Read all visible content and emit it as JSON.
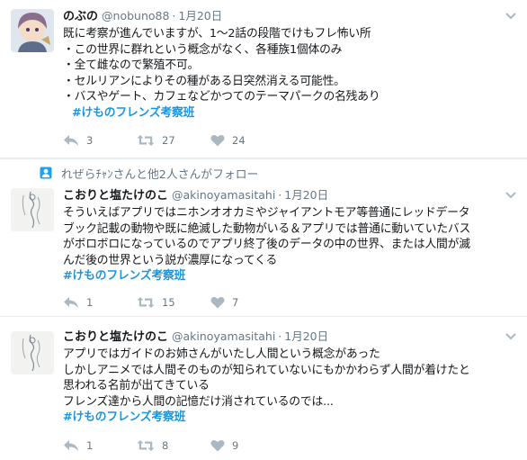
{
  "tweets": [
    {
      "name": "のぶの",
      "handle": "@nobuno88",
      "separator": "·",
      "time": "1月20日",
      "lines": [
        "既に考察が進んでいますが、1〜2話の段階でけもフレ怖い所",
        "・この世界に群れという概念がなく、各種族1個体のみ",
        "・全て雌なので繁殖不可。",
        "・セルリアンによりその種がある日突然消える可能性。",
        "・バスやゲート、カフェなどかつてのテーマパークの名残あり"
      ],
      "hashtag": "#けものフレンズ考察班",
      "replies": "3",
      "retweets": "27",
      "likes": "24"
    },
    {
      "name": "こおりと塩たけのこ",
      "handle": "@akinoyamasitahi",
      "separator": "·",
      "time": "1月20日",
      "lines": [
        "そういえばアプリではニホンオオカミやジャイアントモア等普通にレッドデータ",
        "ブック記載の動物や既に絶滅した動物がいる＆アプリでは普通に動いていたバス",
        "がボロボロになっているのでアプリ終了後のデータの中の世界、または人間が滅",
        "んだ後の世界という説が濃厚になってくる"
      ],
      "hashtag": "#けものフレンズ考察班",
      "replies": "1",
      "retweets": "15",
      "likes": "7"
    },
    {
      "name": "こおりと塩たけのこ",
      "handle": "@akinoyamasitahi",
      "separator": "·",
      "time": "1月20日",
      "lines": [
        "アプリではガイドのお姉さんがいたし人間という概念があった",
        "しかしアニメでは人間そのものが知られていないにもかかわらず人間が着けたと",
        "思われる名前が出てきている",
        "フレンズ達から人間の記憶だけ消されているのでは..."
      ],
      "hashtag": "#けものフレンズ考察班",
      "replies": "1",
      "retweets": "8",
      "likes": "9"
    }
  ],
  "follow_context": "れぜらﾁｬﾝさんと他2人さんがフォロー",
  "colors": {
    "reply": "#aab8c2",
    "retweet": "#aab8c2",
    "like": "#aab8c2",
    "hashtag": "#1b95e0",
    "follow_icon": "#1da1f2"
  },
  "icons": [
    "reply-icon",
    "retweet-icon",
    "heart-icon",
    "caret-down-icon",
    "follow-person-icon"
  ]
}
